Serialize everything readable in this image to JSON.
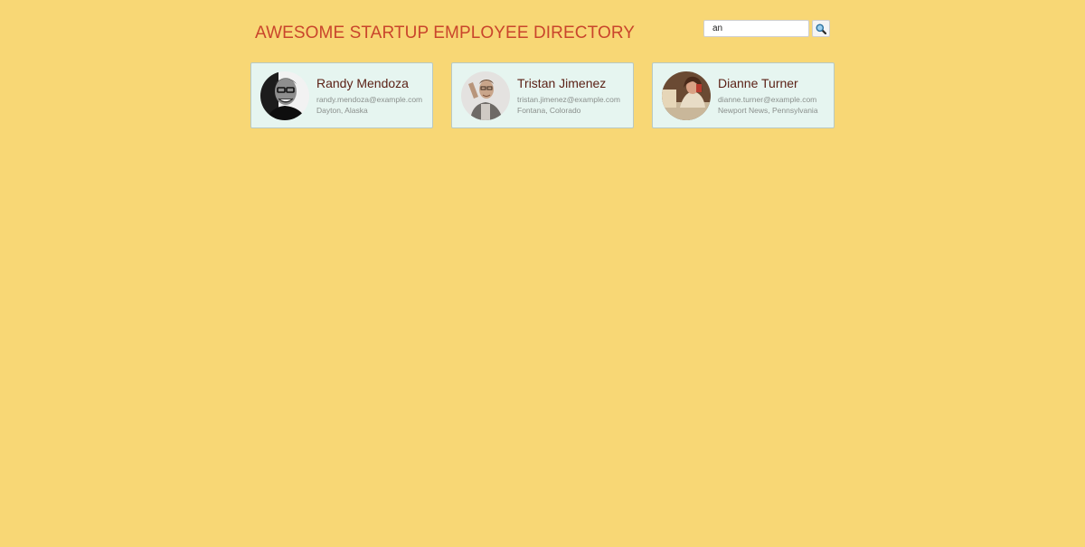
{
  "header": {
    "title": "AWESOME STARTUP EMPLOYEE DIRECTORY"
  },
  "search": {
    "value": "an",
    "button_icon": "search-icon"
  },
  "employees": [
    {
      "name": "Randy Mendoza",
      "email": "randy.mendoza@example.com",
      "location": "Dayton, Alaska"
    },
    {
      "name": "Tristan Jimenez",
      "email": "tristan.jimenez@example.com",
      "location": "Fontana, Colorado"
    },
    {
      "name": "Dianne Turner",
      "email": "dianne.turner@example.com",
      "location": "Newport News, Pennsylvania"
    }
  ],
  "colors": {
    "page_background": "#f8d775",
    "title": "#c9452c",
    "card_background": "#e6f5f0",
    "name": "#5a1f14"
  }
}
